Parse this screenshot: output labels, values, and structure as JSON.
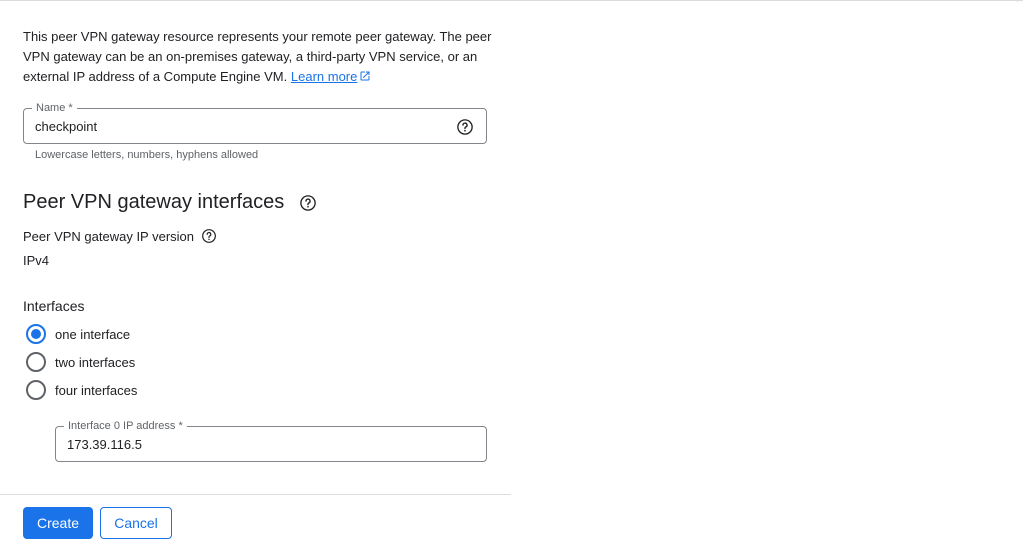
{
  "intro": {
    "text": "This peer VPN gateway resource represents your remote peer gateway. The peer VPN gateway can be an on-premises gateway, a third-party VPN service, or an external IP address of a Compute Engine VM.",
    "learn_more": "Learn more"
  },
  "name_field": {
    "label": "Name *",
    "value": "checkpoint",
    "hint": "Lowercase letters, numbers, hyphens allowed"
  },
  "interfaces_section": {
    "title": "Peer VPN gateway interfaces",
    "ip_version_label": "Peer VPN gateway IP version",
    "ip_version_value": "IPv4",
    "interfaces_label": "Interfaces",
    "options": [
      {
        "label": "one interface",
        "checked": true
      },
      {
        "label": "two interfaces",
        "checked": false
      },
      {
        "label": "four interfaces",
        "checked": false
      }
    ],
    "ip_field": {
      "label": "Interface 0 IP address *",
      "value": "173.39.116.5"
    }
  },
  "actions": {
    "create": "Create",
    "cancel": "Cancel"
  },
  "colors": {
    "accent": "#1a73e8",
    "text": "#202124",
    "secondary": "#5f6368"
  }
}
